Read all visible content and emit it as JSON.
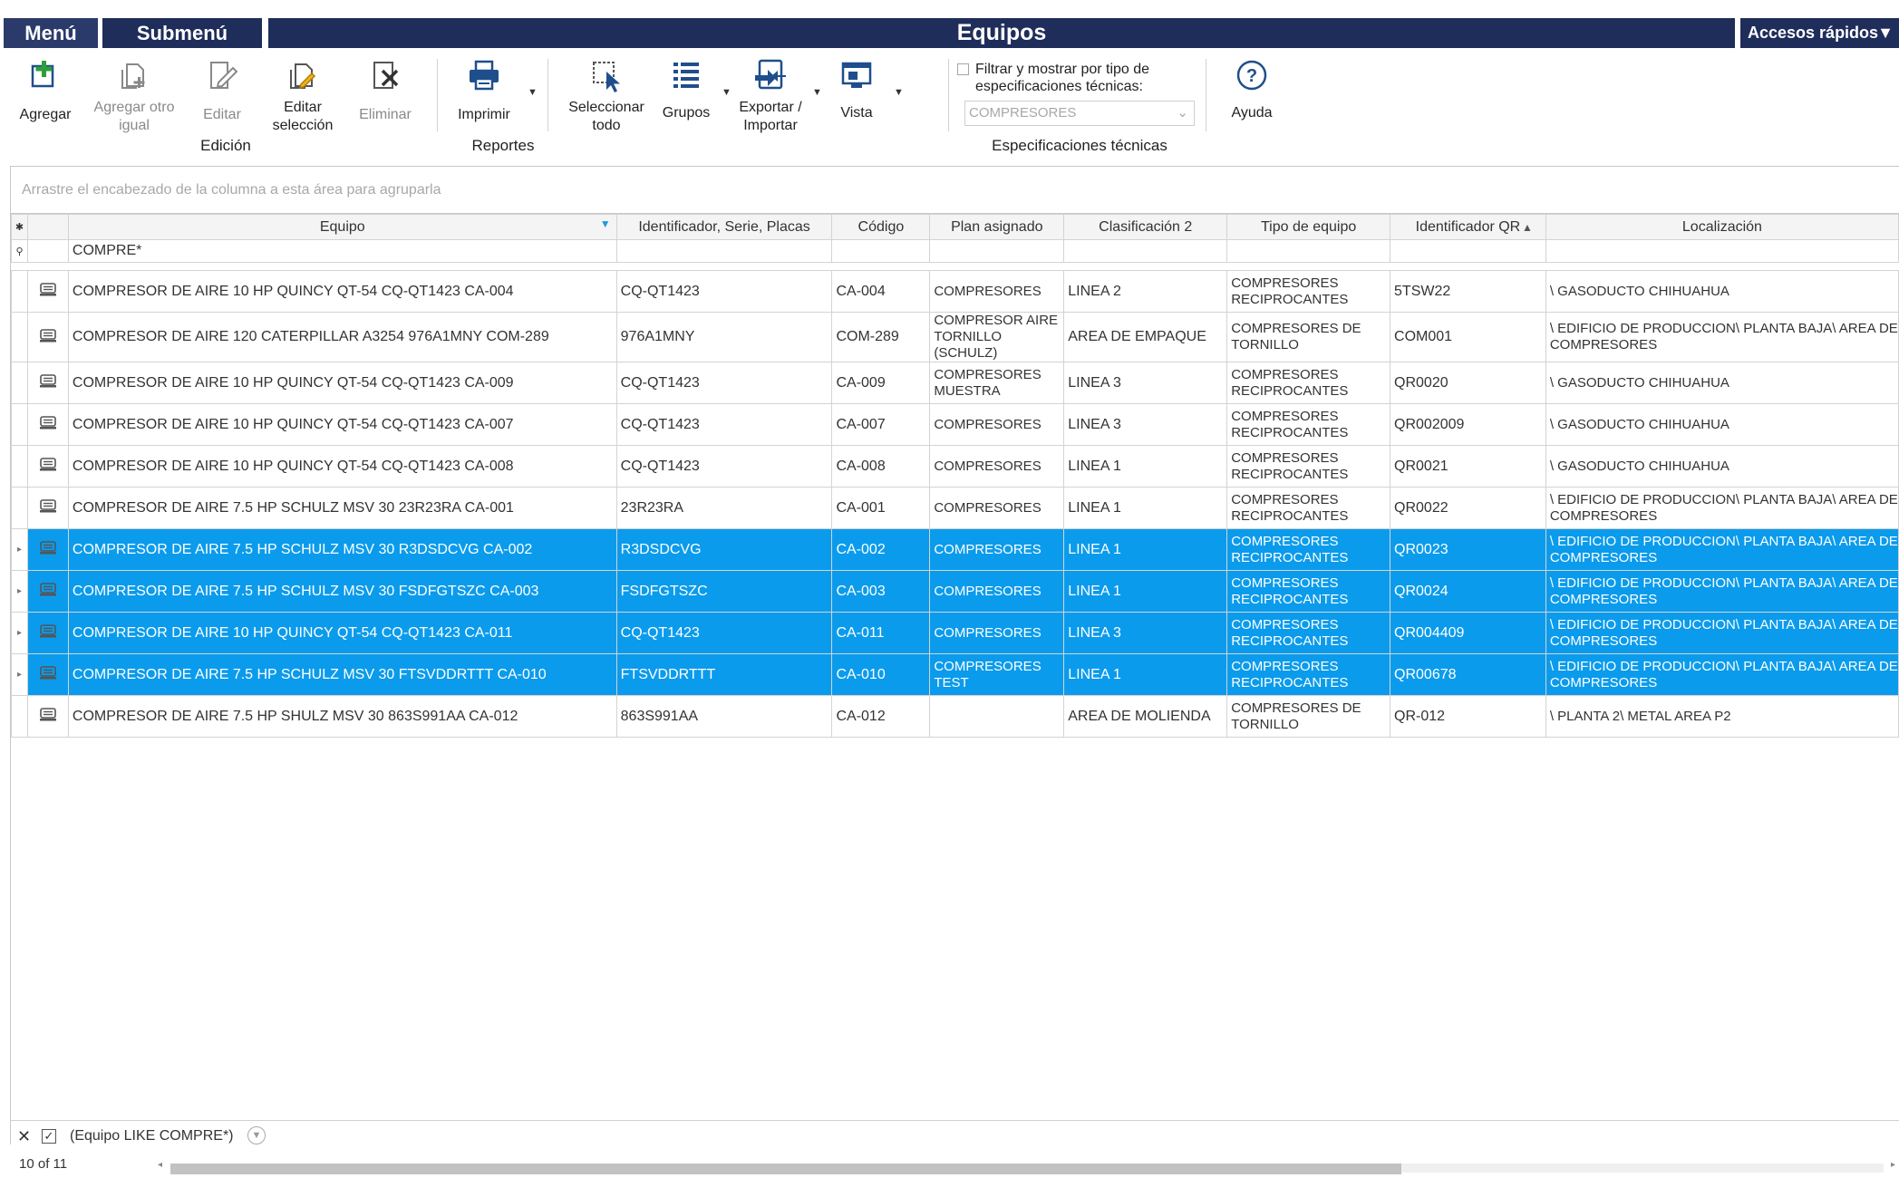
{
  "menubar": {
    "menu": "Menú",
    "submenu": "Submenú",
    "title": "Equipos",
    "quick_access": "Accesos rápidos"
  },
  "ribbon": {
    "buttons": {
      "agregar": "Agregar",
      "agregar_otro": "Agregar otro\nigual",
      "editar": "Editar",
      "editar_seleccion": "Editar\nselección",
      "eliminar": "Eliminar",
      "imprimir": "Imprimir",
      "seleccionar_todo": "Seleccionar\ntodo",
      "grupos": "Grupos",
      "exportar": "Exportar /\nImportar",
      "vista": "Vista",
      "ayuda": "Ayuda"
    },
    "groups": {
      "edicion": "Edición",
      "reportes": "Reportes",
      "especificaciones": "Especificaciones técnicas"
    },
    "spec_filter_label": "Filtrar y mostrar por tipo de especificaciones técnicas:",
    "spec_filter_checked": false,
    "spec_select_value": "COMPRESORES"
  },
  "grid": {
    "group_panel_hint": "Arrastre el encabezado de la columna a esta área para agruparla",
    "columns": [
      "Equipo",
      "Identificador, Serie, Placas",
      "Código",
      "Plan asignado",
      "Clasificación 2",
      "Tipo de equipo",
      "Identificador QR",
      "Localización"
    ],
    "filter_value": "COMPRE*",
    "sort_column": "Identificador QR",
    "sort_direction": "asc",
    "rows": [
      {
        "equipo": "COMPRESOR DE AIRE 10 HP QUINCY QT-54 CQ-QT1423 CA-004",
        "id": "CQ-QT1423",
        "codigo": "CA-004",
        "plan": "COMPRESORES",
        "clasif": "LINEA 2",
        "tipo": "COMPRESORES RECIPROCANTES",
        "qr": "5TSW22",
        "loc": "\\ GASODUCTO CHIHUAHUA",
        "selected": false
      },
      {
        "equipo": "COMPRESOR DE AIRE 120 CATERPILLAR A3254 976A1MNY COM-289",
        "id": "976A1MNY",
        "codigo": "COM-289",
        "plan": "COMPRESOR AIRE TORNILLO (SCHULZ)",
        "clasif": "AREA DE EMPAQUE",
        "tipo": "COMPRESORES DE TORNILLO",
        "qr": "COM001",
        "loc": "\\ EDIFICIO DE PRODUCCION\\ PLANTA BAJA\\ AREA DE COMPRESORES",
        "selected": false
      },
      {
        "equipo": "COMPRESOR DE AIRE 10 HP QUINCY QT-54 CQ-QT1423 CA-009",
        "id": "CQ-QT1423",
        "codigo": "CA-009",
        "plan": "COMPRESORES MUESTRA",
        "clasif": "LINEA 3",
        "tipo": "COMPRESORES RECIPROCANTES",
        "qr": "QR0020",
        "loc": "\\ GASODUCTO CHIHUAHUA",
        "selected": false
      },
      {
        "equipo": "COMPRESOR DE AIRE 10 HP QUINCY QT-54 CQ-QT1423 CA-007",
        "id": "CQ-QT1423",
        "codigo": "CA-007",
        "plan": "COMPRESORES",
        "clasif": "LINEA 3",
        "tipo": "COMPRESORES RECIPROCANTES",
        "qr": "QR002009",
        "loc": "\\ GASODUCTO CHIHUAHUA",
        "selected": false
      },
      {
        "equipo": "COMPRESOR DE AIRE 10 HP QUINCY QT-54 CQ-QT1423 CA-008",
        "id": "CQ-QT1423",
        "codigo": "CA-008",
        "plan": "COMPRESORES",
        "clasif": "LINEA 1",
        "tipo": "COMPRESORES RECIPROCANTES",
        "qr": "QR0021",
        "loc": "\\ GASODUCTO CHIHUAHUA",
        "selected": false
      },
      {
        "equipo": "COMPRESOR DE AIRE 7.5 HP SCHULZ MSV 30 23R23RA CA-001",
        "id": "23R23RA",
        "codigo": "CA-001",
        "plan": "COMPRESORES",
        "clasif": "LINEA 1",
        "tipo": "COMPRESORES RECIPROCANTES",
        "qr": "QR0022",
        "loc": "\\ EDIFICIO DE PRODUCCION\\ PLANTA BAJA\\ AREA DE COMPRESORES",
        "selected": false
      },
      {
        "equipo": "COMPRESOR DE AIRE 7.5 HP SCHULZ MSV 30 R3DSDCVG CA-002",
        "id": "R3DSDCVG",
        "codigo": "CA-002",
        "plan": "COMPRESORES",
        "clasif": "LINEA 1",
        "tipo": "COMPRESORES RECIPROCANTES",
        "qr": "QR0023",
        "loc": "\\ EDIFICIO DE PRODUCCION\\ PLANTA BAJA\\ AREA DE COMPRESORES",
        "selected": true
      },
      {
        "equipo": "COMPRESOR DE AIRE 7.5 HP SCHULZ MSV 30 FSDFGTSZC CA-003",
        "id": "FSDFGTSZC",
        "codigo": "CA-003",
        "plan": "COMPRESORES",
        "clasif": "LINEA 1",
        "tipo": "COMPRESORES RECIPROCANTES",
        "qr": "QR0024",
        "loc": "\\ EDIFICIO DE PRODUCCION\\ PLANTA BAJA\\ AREA DE COMPRESORES",
        "selected": true
      },
      {
        "equipo": "COMPRESOR DE AIRE 10 HP QUINCY QT-54 CQ-QT1423 CA-011",
        "id": "CQ-QT1423",
        "codigo": "CA-011",
        "plan": "COMPRESORES",
        "clasif": "LINEA 3",
        "tipo": "COMPRESORES RECIPROCANTES",
        "qr": "QR004409",
        "loc": "\\ EDIFICIO DE PRODUCCION\\ PLANTA BAJA\\ AREA DE COMPRESORES",
        "selected": true
      },
      {
        "equipo": "COMPRESOR DE AIRE 7.5 HP SCHULZ MSV 30 FTSVDDRTTT CA-010",
        "id": "FTSVDDRTTT",
        "codigo": "CA-010",
        "plan": "COMPRESORES TEST",
        "clasif": "LINEA 1",
        "tipo": "COMPRESORES RECIPROCANTES",
        "qr": "QR00678",
        "loc": "\\ EDIFICIO DE PRODUCCION\\ PLANTA BAJA\\ AREA DE COMPRESORES",
        "selected": true
      },
      {
        "equipo": "COMPRESOR DE AIRE 7.5 HP SHULZ MSV 30 863S991AA CA-012",
        "id": "863S991AA",
        "codigo": "CA-012",
        "plan": "",
        "clasif": "AREA DE MOLIENDA",
        "tipo": "COMPRESORES DE TORNILLO",
        "qr": "QR-012",
        "loc": "\\ PLANTA 2\\ METAL AREA P2",
        "selected": false
      }
    ]
  },
  "footer": {
    "filter_expression": "(Equipo LIKE COMPRE*)",
    "filter_enabled": true,
    "record_count": "10 of 11"
  },
  "colors": {
    "menubar": "#1f2d5a",
    "selection": "#0b9bec",
    "icon_green": "#2e9e3a",
    "icon_blue": "#1f4e8c"
  }
}
